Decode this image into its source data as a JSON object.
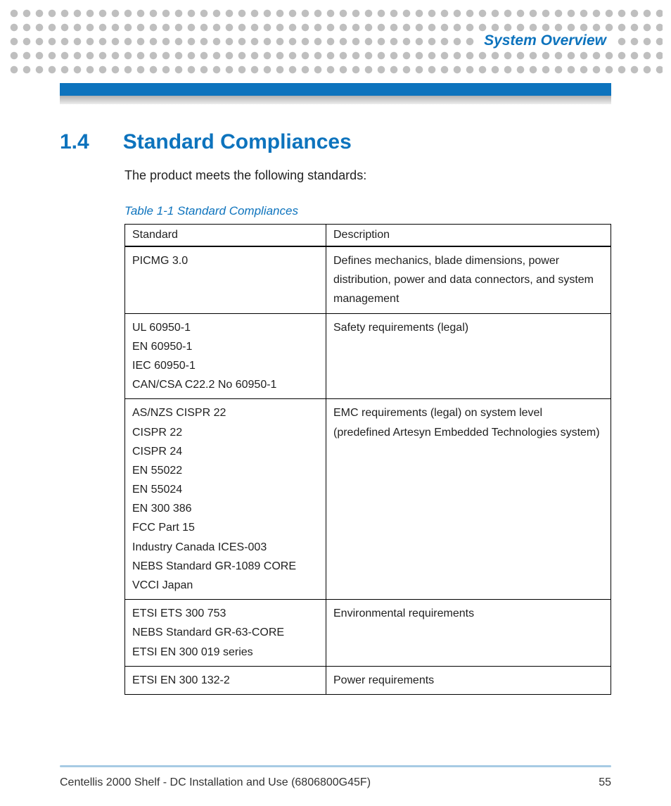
{
  "header": {
    "running_title": "System Overview"
  },
  "section": {
    "number": "1.4",
    "title": "Standard Compliances",
    "intro": "The product meets the following standards:"
  },
  "table": {
    "caption": "Table 1-1 Standard Compliances",
    "columns": {
      "c0": "Standard",
      "c1": "Description"
    },
    "rows": [
      {
        "standard": "PICMG 3.0",
        "description": "Defines mechanics, blade dimensions, power distribution, power and data connectors, and system management"
      },
      {
        "standard": "UL 60950-1\nEN 60950-1\nIEC 60950-1\nCAN/CSA C22.2 No 60950-1",
        "description": "Safety requirements (legal)"
      },
      {
        "standard": "AS/NZS CISPR 22\nCISPR 22\nCISPR 24\nEN 55022\nEN 55024\nEN 300 386\nFCC Part 15\nIndustry Canada ICES-003\nNEBS Standard GR-1089 CORE\nVCCI Japan",
        "description": "EMC requirements (legal) on system level\n(predefined Artesyn Embedded Technologies system)"
      },
      {
        "standard": "ETSI ETS 300 753\nNEBS Standard GR-63-CORE\nETSI EN 300 019 series",
        "description": "Environmental requirements"
      },
      {
        "standard": "ETSI EN 300 132-2",
        "description": "Power requirements"
      }
    ]
  },
  "footer": {
    "doc_title": "Centellis 2000 Shelf - DC Installation and Use (6806800G45F)",
    "page_number": "55"
  }
}
